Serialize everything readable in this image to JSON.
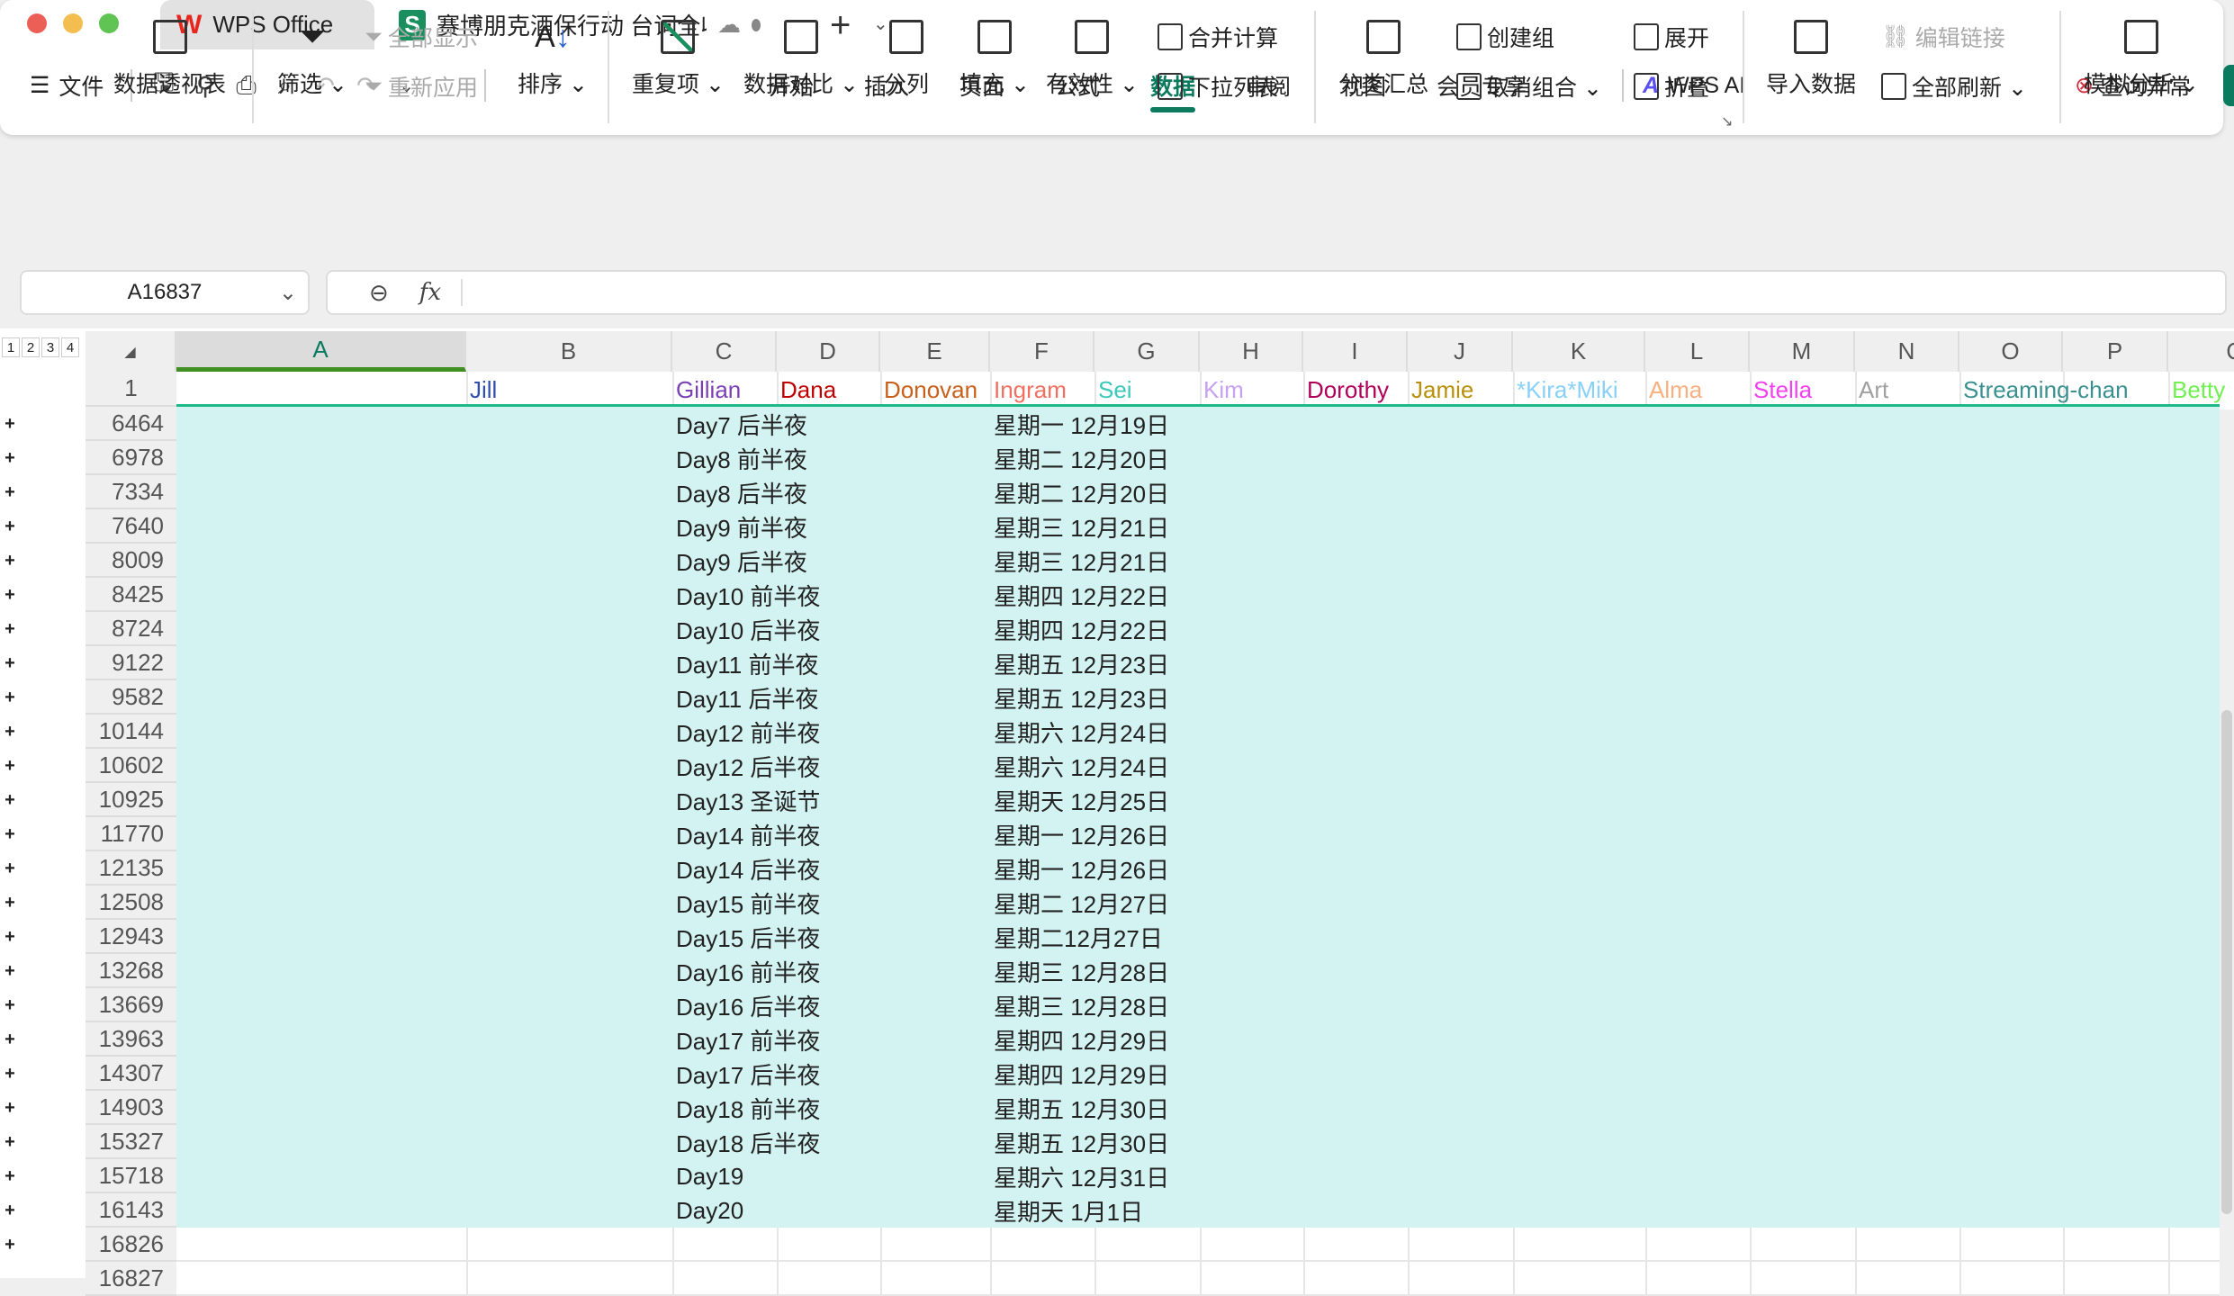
{
  "titlebar": {
    "tabs": [
      {
        "label": "WPS Office"
      },
      {
        "label": "赛博朋克酒保行动 台词全收"
      }
    ],
    "new_tab": "+"
  },
  "toolbar": {
    "file": "文件",
    "menu_tabs": [
      "开始",
      "插入",
      "页面",
      "公式",
      "数据",
      "审阅",
      "视图",
      "会员专享"
    ],
    "active_tab": "数据",
    "wps_ai": "WPS AI",
    "query_error": "查询异常"
  },
  "ribbon": {
    "pivot": "数据透视表",
    "filter": "筛选",
    "show_all": "全部显示",
    "reapply": "重新应用",
    "sort": "排序",
    "duplicates": "重复项",
    "compare": "数据对比",
    "split": "分列",
    "fill": "填充",
    "validity": "有效性",
    "consolidate": "合并计算",
    "dropdown": "下拉列表",
    "subtotal": "分类汇总",
    "group": "创建组",
    "ungroup": "取消组合",
    "expand": "展开",
    "collapse": "折叠",
    "import": "导入数据",
    "edit_links": "编辑链接",
    "refresh_all": "全部刷新",
    "what_if": "模拟分析"
  },
  "formula_bar": {
    "name_box": "A16837",
    "fx": "fx",
    "value": ""
  },
  "outline_levels": [
    "1",
    "2",
    "3",
    "4"
  ],
  "columns": [
    "A",
    "B",
    "C",
    "D",
    "E",
    "F",
    "G",
    "H",
    "I",
    "J",
    "K",
    "L",
    "M",
    "N",
    "O",
    "P",
    "Q"
  ],
  "header_row": {
    "row": "1",
    "names": [
      {
        "col": "B",
        "text": "Jill",
        "color": "#2f4fb0"
      },
      {
        "col": "C",
        "text": "Gillian",
        "color": "#7b3fb5"
      },
      {
        "col": "D",
        "text": "Dana",
        "color": "#c00000"
      },
      {
        "col": "E",
        "text": "Donovan",
        "color": "#c8601a"
      },
      {
        "col": "F",
        "text": "Ingram",
        "color": "#f07060"
      },
      {
        "col": "G",
        "text": "Sei",
        "color": "#3cc8b8"
      },
      {
        "col": "H",
        "text": "Kim",
        "color": "#c8a0f0"
      },
      {
        "col": "I",
        "text": "Dorothy",
        "color": "#b0005a"
      },
      {
        "col": "J",
        "text": "Jamie",
        "color": "#b8900a"
      },
      {
        "col": "K",
        "text": "*Kira*Miki",
        "color": "#88d0f8"
      },
      {
        "col": "L",
        "text": "Alma",
        "color": "#f8b080"
      },
      {
        "col": "M",
        "text": "Stella",
        "color": "#f040f0"
      },
      {
        "col": "N",
        "text": "Art",
        "color": "#a0a0a0"
      },
      {
        "col": "O",
        "text": "Streaming-chan",
        "color": "#3a9090"
      },
      {
        "col": "Q",
        "text": "Betty",
        "color": "#70f050"
      }
    ]
  },
  "rows": [
    {
      "n": "6464",
      "day": "Day7 后半夜",
      "date": "星期一 12月19日"
    },
    {
      "n": "6978",
      "day": "Day8 前半夜",
      "date": "星期二 12月20日"
    },
    {
      "n": "7334",
      "day": "Day8 后半夜",
      "date": "星期二 12月20日"
    },
    {
      "n": "7640",
      "day": "Day9 前半夜",
      "date": "星期三 12月21日"
    },
    {
      "n": "8009",
      "day": "Day9 后半夜",
      "date": "星期三 12月21日"
    },
    {
      "n": "8425",
      "day": "Day10 前半夜",
      "date": "星期四 12月22日"
    },
    {
      "n": "8724",
      "day": "Day10 后半夜",
      "date": "星期四 12月22日"
    },
    {
      "n": "9122",
      "day": "Day11 前半夜",
      "date": "星期五 12月23日"
    },
    {
      "n": "9582",
      "day": "Day11 后半夜",
      "date": "星期五 12月23日"
    },
    {
      "n": "10144",
      "day": "Day12 前半夜",
      "date": "星期六 12月24日"
    },
    {
      "n": "10602",
      "day": "Day12 后半夜",
      "date": "星期六 12月24日"
    },
    {
      "n": "10925",
      "day": "Day13 圣诞节",
      "date": "星期天 12月25日"
    },
    {
      "n": "11770",
      "day": "Day14 前半夜",
      "date": "星期一 12月26日"
    },
    {
      "n": "12135",
      "day": "Day14 后半夜",
      "date": "星期一 12月26日"
    },
    {
      "n": "12508",
      "day": "Day15 前半夜",
      "date": "星期二 12月27日"
    },
    {
      "n": "12943",
      "day": "Day15 后半夜",
      "date": "星期二12月27日"
    },
    {
      "n": "13268",
      "day": "Day16 前半夜",
      "date": "星期三 12月28日"
    },
    {
      "n": "13669",
      "day": "Day16 后半夜",
      "date": "星期三 12月28日"
    },
    {
      "n": "13963",
      "day": "Day17 前半夜",
      "date": "星期四 12月29日"
    },
    {
      "n": "14307",
      "day": "Day17 后半夜",
      "date": "星期四 12月29日"
    },
    {
      "n": "14903",
      "day": "Day18 前半夜",
      "date": "星期五 12月30日"
    },
    {
      "n": "15327",
      "day": "Day18 后半夜",
      "date": "星期五 12月30日"
    },
    {
      "n": "15718",
      "day": "Day19",
      "date": "星期六 12月31日"
    },
    {
      "n": "16143",
      "day": "Day20",
      "date": "星期天 1月1日"
    }
  ],
  "empty_rows": [
    "16826",
    "16827"
  ],
  "colors": {
    "accent": "#0b7a5e",
    "highlight": "#d2f3f1",
    "selected_col": "#3f8f23"
  }
}
